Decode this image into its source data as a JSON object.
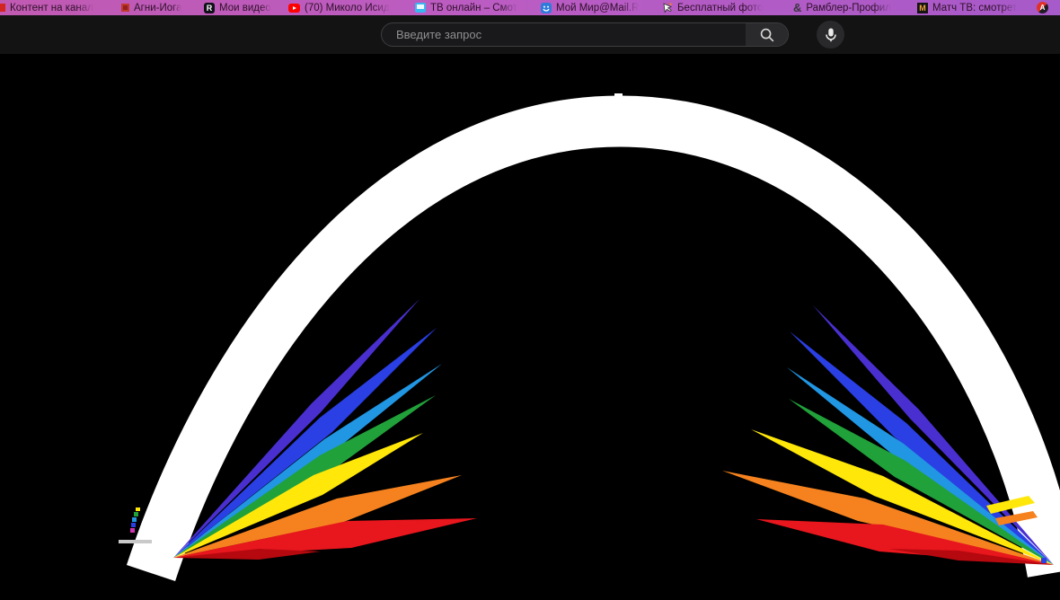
{
  "browser": {
    "bookmarks_bar": {
      "items": [
        {
          "label": "Контент на канал",
          "icon": "red-site-favicon"
        },
        {
          "label": "Агни-Йога",
          "icon": "red-square-favicon"
        },
        {
          "label": "Мои видео",
          "icon": "rutube-favicon",
          "glyph": "R"
        },
        {
          "label": "(70) Миколо Исид",
          "icon": "youtube-favicon"
        },
        {
          "label": "ТВ онлайн – Смот",
          "icon": "tv-favicon"
        },
        {
          "label": "Мой Мир@Mail.R",
          "icon": "moimir-smiley-favicon"
        },
        {
          "label": "Бесплатный фото",
          "icon": "cursor-favicon"
        },
        {
          "label": "Рамблер-Профил",
          "icon": "rambler-ampersand-favicon",
          "glyph": "&"
        },
        {
          "label": "Матч ТВ: смотрет",
          "icon": "match-tv-favicon",
          "glyph": "M"
        },
        {
          "label": "",
          "icon": "a-badge-favicon",
          "glyph": "A"
        }
      ]
    },
    "search": {
      "placeholder": "Введите запрос"
    }
  },
  "visual": {
    "description": "White parabolic arc of light on black background dispersing into two rainbow spectrum ray fans, with a small grey input beam at the lower left",
    "spectrum": {
      "white": "#ffffff",
      "violet": "#4a2fd0",
      "blue": "#2a3fe4",
      "cyan": "#2196e3",
      "green": "#21a13a",
      "yellow": "#ffe70a",
      "orange": "#f5821f",
      "red": "#e8161d",
      "darkred": "#b5090f",
      "beam_grey": "#c9c9c9"
    },
    "ui_colors": {
      "bookmarks_bar_left": "#c05ab2",
      "bookmarks_bar_right": "#a75ac9",
      "toolbar_bg": "#131314",
      "page_bg": "#000000"
    }
  }
}
